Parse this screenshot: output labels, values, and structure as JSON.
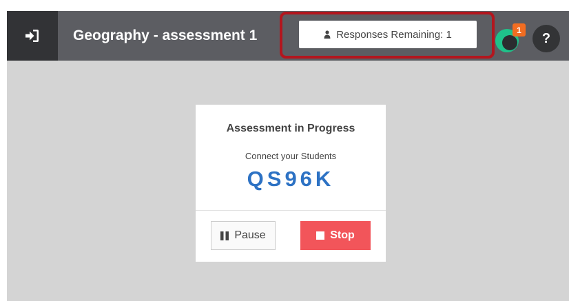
{
  "header": {
    "exit_icon": "exit-icon",
    "title": "Geography - assessment 1",
    "responses_label": "Responses Remaining: 1",
    "responses_icon": "user-icon",
    "notification_count": "1",
    "help_label": "?"
  },
  "card": {
    "title": "Assessment in Progress",
    "subtitle": "Connect your Students",
    "code": "QS96K",
    "pause_label": "Pause",
    "pause_icon": "pause-icon",
    "stop_label": "Stop",
    "stop_icon": "stop-icon"
  },
  "colors": {
    "topbar": "#5c5d62",
    "exit_button_bg": "#323336",
    "highlight_border": "#b3161e",
    "code_blue": "#2d72c4",
    "stop_red": "#f2555a",
    "badge_orange": "#f26d21",
    "avatar_green": "#1fc28a",
    "background": "#d4d4d4"
  }
}
